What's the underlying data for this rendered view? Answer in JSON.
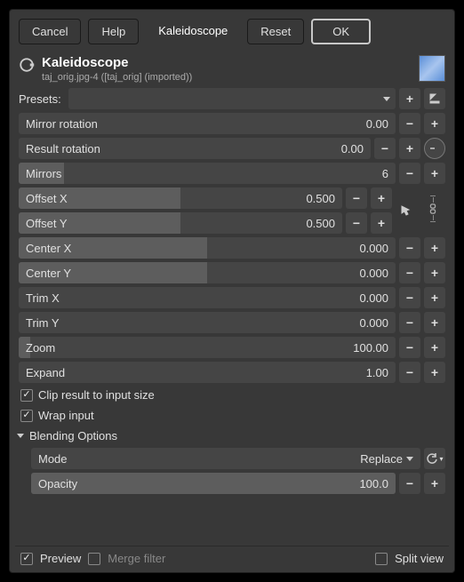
{
  "buttons": {
    "cancel": "Cancel",
    "help": "Help",
    "tab": "Kaleidoscope",
    "reset": "Reset",
    "ok": "OK"
  },
  "header": {
    "title": "Kaleidoscope",
    "subtitle": "taj_orig.jpg-4 ([taj_orig] (imported))"
  },
  "presets": {
    "label": "Presets:"
  },
  "params": {
    "mirror_rotation": {
      "label": "Mirror rotation",
      "value": "0.00",
      "fill": 0
    },
    "result_rotation": {
      "label": "Result rotation",
      "value": "0.00",
      "fill": 0
    },
    "mirrors": {
      "label": "Mirrors",
      "value": "6",
      "fill": 12
    },
    "offset_x": {
      "label": "Offset X",
      "value": "0.500",
      "fill": 50
    },
    "offset_y": {
      "label": "Offset Y",
      "value": "0.500",
      "fill": 50
    },
    "center_x": {
      "label": "Center X",
      "value": "0.000",
      "fill": 50
    },
    "center_y": {
      "label": "Center Y",
      "value": "0.000",
      "fill": 50
    },
    "trim_x": {
      "label": "Trim X",
      "value": "0.000",
      "fill": 0
    },
    "trim_y": {
      "label": "Trim Y",
      "value": "0.000",
      "fill": 0
    },
    "zoom": {
      "label": "Zoom",
      "value": "100.00",
      "fill": 1
    },
    "expand": {
      "label": "Expand",
      "value": "1.00",
      "fill": 0
    }
  },
  "checks": {
    "clip": "Clip result to input size",
    "wrap": "Wrap input"
  },
  "blending": {
    "title": "Blending Options",
    "mode_label": "Mode",
    "mode_value": "Replace",
    "opacity_label": "Opacity",
    "opacity_value": "100.0"
  },
  "footer": {
    "preview": "Preview",
    "merge": "Merge filter",
    "split": "Split view"
  }
}
